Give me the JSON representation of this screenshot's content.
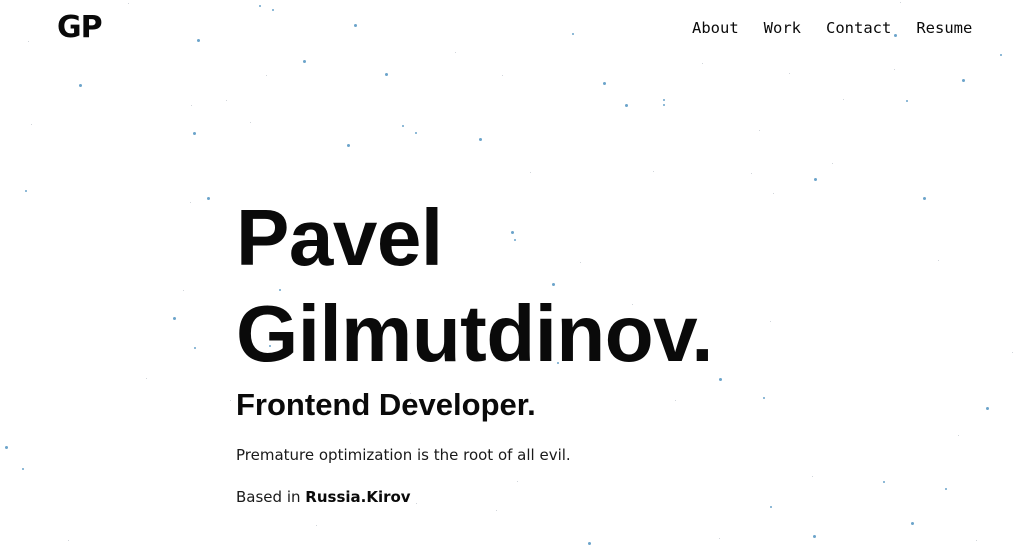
{
  "header": {
    "logo": "GP",
    "nav": [
      {
        "label": "About"
      },
      {
        "label": "Work"
      },
      {
        "label": "Contact"
      },
      {
        "label": "Resume"
      }
    ]
  },
  "hero": {
    "name_line1": "Pavel",
    "name_line2": "Gilmutdinov.",
    "role": "Frontend Developer.",
    "quote": "Premature optimization is the root of all evil.",
    "location_prefix": "Based in",
    "location_value": "Russia.Kirov"
  },
  "colors": {
    "text": "#0a0a0a",
    "background": "#ffffff",
    "star_blue": "#5b9ac4",
    "star_gray": "#9aa4ad"
  }
}
